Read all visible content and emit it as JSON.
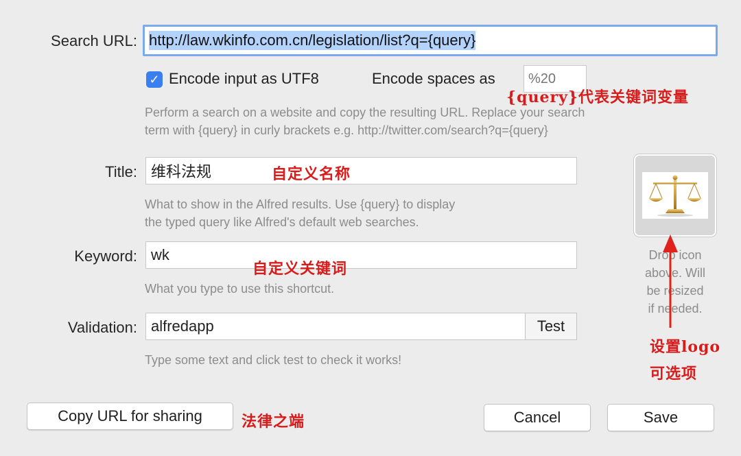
{
  "search_url": {
    "label": "Search URL:",
    "value": "http://law.wkinfo.com.cn/legislation/list?q={query}"
  },
  "encode_utf8": {
    "label": "Encode input as UTF8",
    "checked": true
  },
  "encode_spaces": {
    "label": "Encode spaces as",
    "placeholder": "%20"
  },
  "url_help": {
    "line1": "Perform a search on a website and copy the resulting URL. Replace your search",
    "line2": "term with {query} in curly brackets e.g. http://twitter.com/search?q={query}"
  },
  "title": {
    "label": "Title:",
    "value": "维科法规",
    "help1": "What to show in the Alfred results. Use {query} to display",
    "help2": "the typed query like Alfred's default web searches."
  },
  "keyword": {
    "label": "Keyword:",
    "value": "wk",
    "help": "What you type to use this shortcut."
  },
  "validation": {
    "label": "Validation:",
    "value": "alfredapp",
    "test_label": "Test",
    "help": "Type some text and click test to check it works!"
  },
  "icon_well": {
    "icon": "scales-of-justice-icon",
    "drop_lines": [
      "Drop icon",
      "above. Will",
      "be resized",
      "if needed."
    ]
  },
  "buttons": {
    "copy_url": "Copy URL for sharing",
    "cancel": "Cancel",
    "save": "Save"
  },
  "annotations": {
    "query_note": "{query}代表关键词变量",
    "title_note": "自定义名称",
    "keyword_note": "自定义关键词",
    "logo_note_1": "设置logo",
    "logo_note_2": "可选项",
    "footer_note": "法律之端"
  },
  "colors": {
    "accent": "#3a7ff0",
    "annotation": "#d81c1c",
    "focus_ring": "#7aa9ec",
    "selection": "#b3d3fc"
  }
}
